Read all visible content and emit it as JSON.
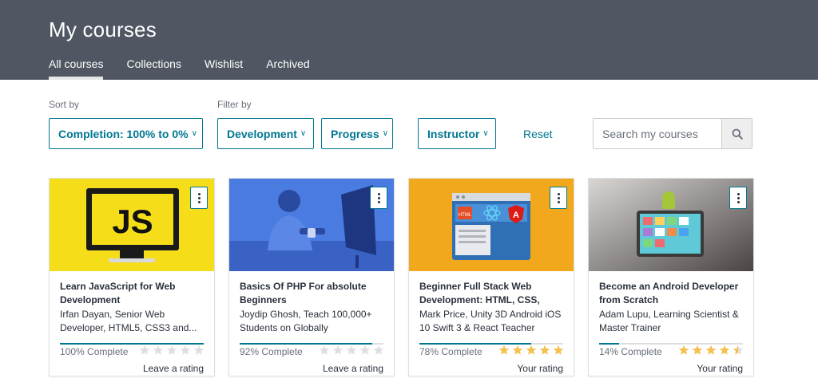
{
  "header": {
    "title": "My courses",
    "tabs": [
      {
        "label": "All courses",
        "active": true
      },
      {
        "label": "Collections",
        "active": false
      },
      {
        "label": "Wishlist",
        "active": false
      },
      {
        "label": "Archived",
        "active": false
      }
    ]
  },
  "filters": {
    "sort_label": "Sort by",
    "filter_label": "Filter by",
    "sort_value": "Completion: 100% to 0%",
    "category_value": "Development",
    "progress_value": "Progress",
    "instructor_value": "Instructor",
    "reset_label": "Reset",
    "chevron_icon": "chevron-down-icon"
  },
  "search": {
    "placeholder": "Search my courses",
    "value": "",
    "icon": "search-icon"
  },
  "courses": [
    {
      "title": "Learn JavaScript for Web Development",
      "instructor": "Irfan Dayan, Senior Web Developer, HTML5, CSS3 and...",
      "progress_text": "100% Complete",
      "progress": 1.0,
      "rating": 0,
      "rating_label": "Leave a rating",
      "thumb_text": "JS"
    },
    {
      "title": "Basics Of PHP For absolute Beginners",
      "instructor": "Joydip Ghosh, Teach 100,000+ Students on Globally",
      "progress_text": "92% Complete",
      "progress": 0.92,
      "rating": 0,
      "rating_label": "Leave a rating"
    },
    {
      "title": "Beginner Full Stack Web Development: HTML, CSS, Rea...",
      "instructor": "Mark Price, Unity 3D Android iOS 10 Swift 3 & React Teacher",
      "progress_text": "78% Complete",
      "progress": 0.78,
      "rating": 5,
      "rating_label": "Your rating",
      "thumb_text": "HTML"
    },
    {
      "title": "Become an Android Developer from Scratch",
      "instructor": "Adam Lupu, Learning Scientist & Master Trainer",
      "progress_text": "14% Complete",
      "progress": 0.14,
      "rating": 4.5,
      "rating_label": "Your rating"
    }
  ],
  "colors": {
    "header_bg": "#505763",
    "accent": "#007791",
    "star_filled": "#f4c150",
    "star_empty": "#dedfe0"
  }
}
